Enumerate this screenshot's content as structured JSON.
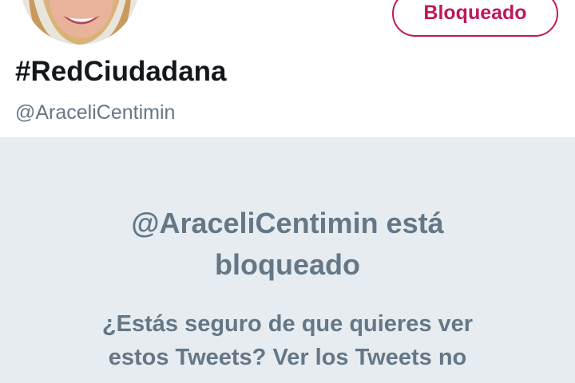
{
  "profile": {
    "display_name": "#RedCiudadana",
    "handle": "@AraceliCentimin",
    "block_button_label": "Bloqueado"
  },
  "blocked_notice": {
    "title_line_1": "@AraceliCentimin está",
    "title_line_2": "bloqueado",
    "message_line_1": "¿Estás seguro de que quieres ver",
    "message_line_2": "estos Tweets? Ver los Tweets no"
  },
  "colors": {
    "accent": "#c0185a",
    "panel_background": "#e6ecf0",
    "muted_text": "#657786",
    "name_text": "#14171a"
  }
}
